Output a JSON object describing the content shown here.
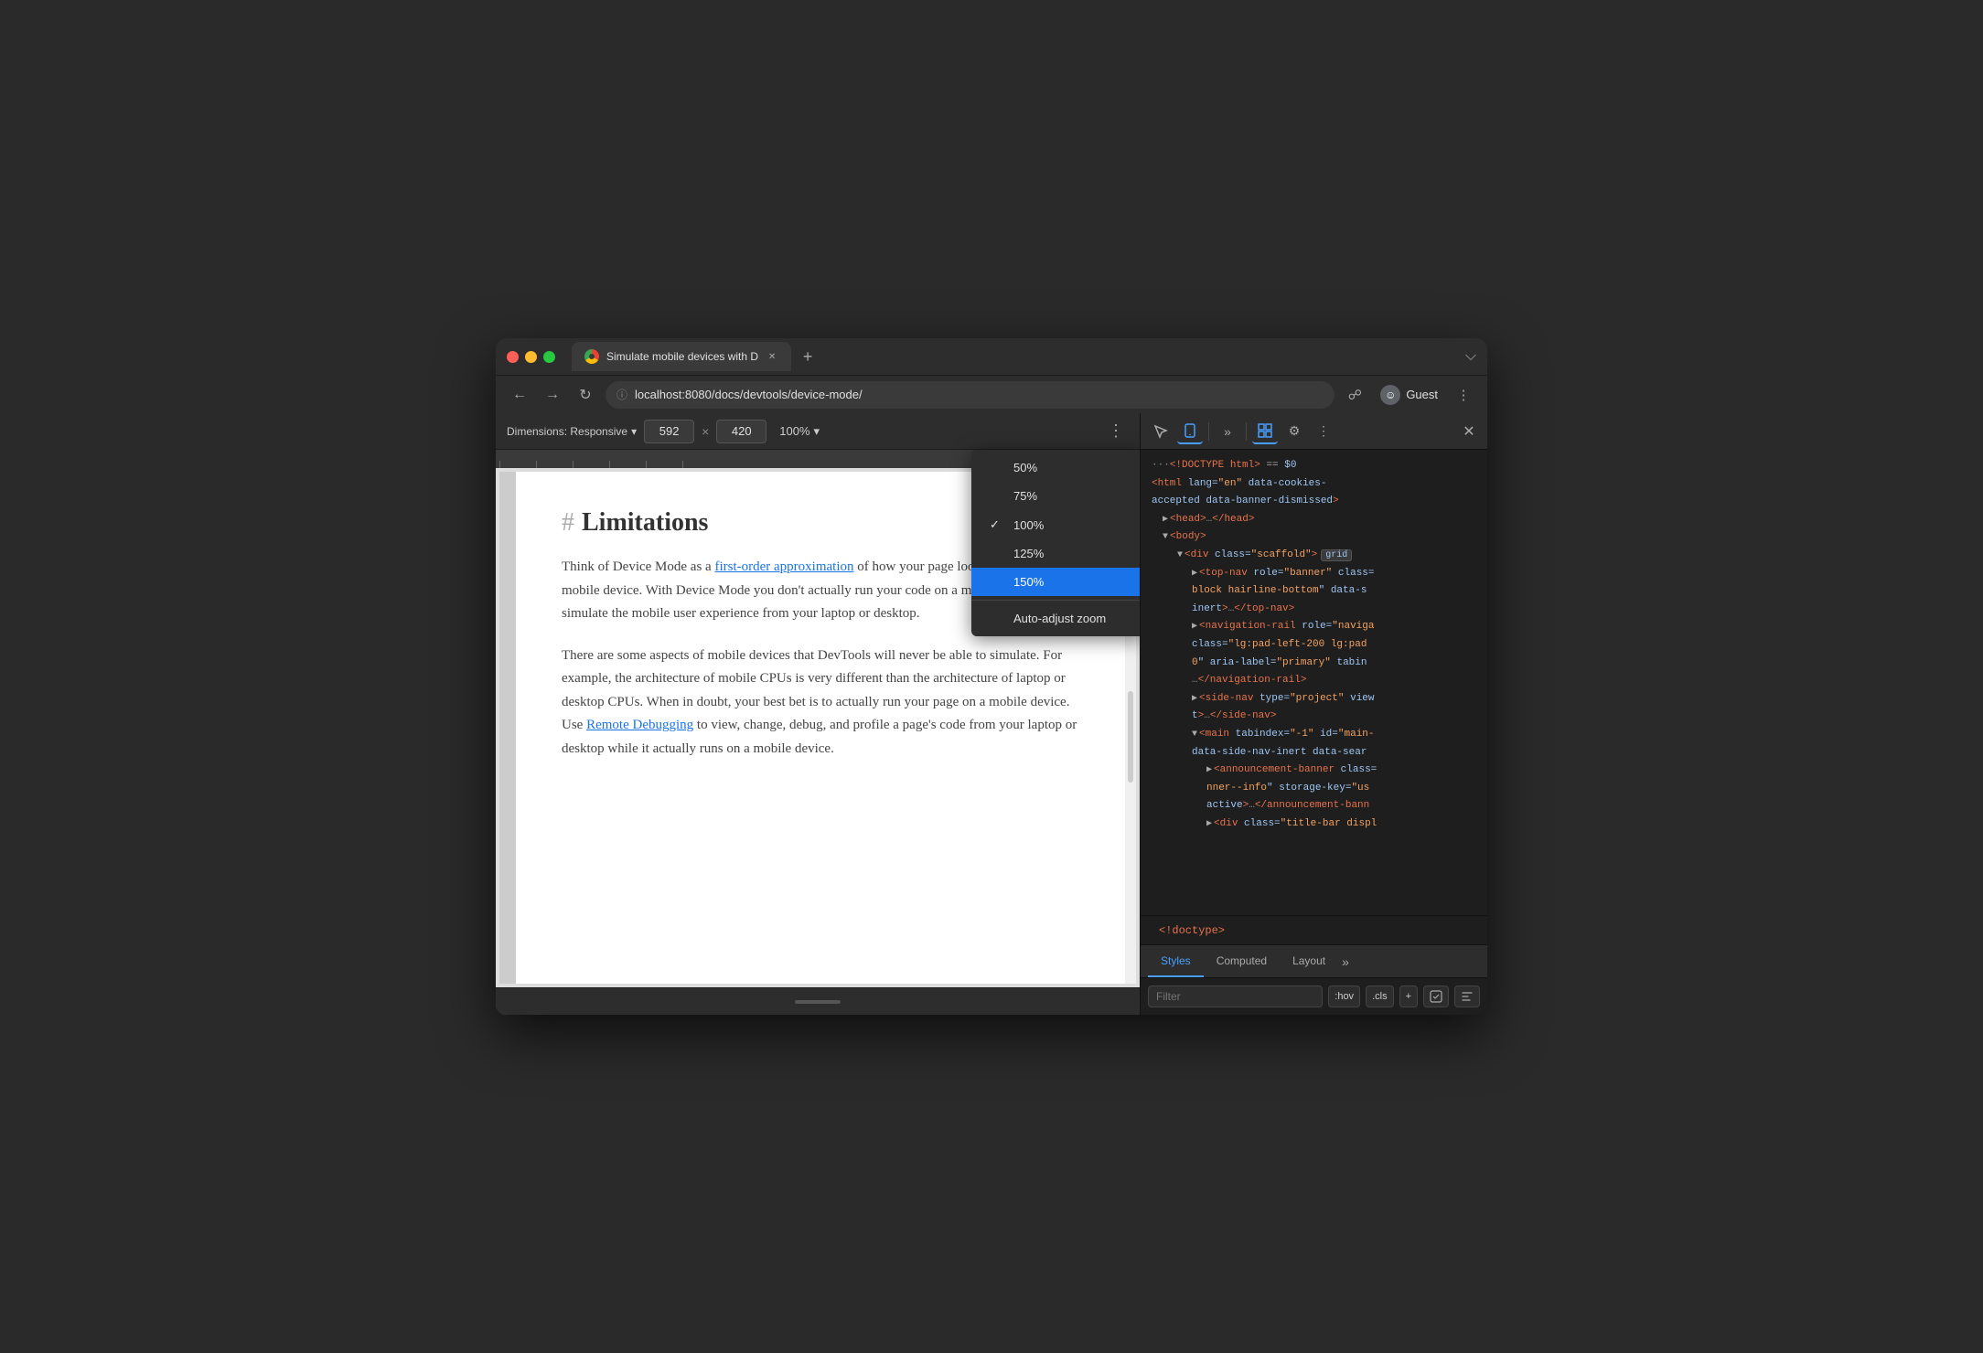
{
  "window": {
    "title": "Chrome Browser",
    "tab_title": "Simulate mobile devices with D",
    "url": "localhost:8080/docs/devtools/device-mode/",
    "profile_name": "Guest"
  },
  "device_toolbar": {
    "dimensions_label": "Dimensions: Responsive",
    "width": "592",
    "height": "420",
    "zoom": "100%",
    "zoom_arrow": "▾"
  },
  "zoom_dropdown": {
    "options": [
      {
        "label": "50%",
        "selected": false,
        "value": "50"
      },
      {
        "label": "75%",
        "selected": false,
        "value": "75"
      },
      {
        "label": "100%",
        "selected": true,
        "value": "100"
      },
      {
        "label": "125%",
        "selected": false,
        "value": "125"
      },
      {
        "label": "150%",
        "selected": false,
        "value": "150"
      }
    ],
    "auto_adjust_label": "Auto-adjust zoom"
  },
  "page": {
    "heading_hash": "#",
    "heading": "Limitations",
    "paragraph1": "Think of Device Mode as a ",
    "link1": "first-order approximation",
    "paragraph1_rest": " of how your page looks and feels on a mobile device. With Device Mode you don't actually run your code on a mobile device. You simulate the mobile user experience from your laptop or desktop.",
    "paragraph2": "There are some aspects of mobile devices that DevTools will never be able to simulate. For example, the architecture of mobile CPUs is very different than the architecture of laptop or desktop CPUs. When in doubt, your best bet is to actually run your page on a mobile device. Use ",
    "link2": "Remote Debugging",
    "paragraph2_rest": " to view, change, debug, and profile a page's code from your laptop or desktop while it actually runs on a mobile device."
  },
  "devtools": {
    "dom_lines": [
      {
        "indent": 0,
        "html": "···<!DOCTYPE html> == $0",
        "type": "comment"
      },
      {
        "indent": 0,
        "html": "<html lang=\"en\" data-cookies-",
        "type": "tag"
      },
      {
        "indent": 0,
        "html": "accepted data-banner-dismissed>",
        "type": "tag"
      },
      {
        "indent": 1,
        "html": "▶ <head>…</head>",
        "type": "tag"
      },
      {
        "indent": 1,
        "html": "▼ <body>",
        "type": "tag"
      },
      {
        "indent": 2,
        "html": "▼ <div class=\"scaffold\">",
        "type": "tag",
        "badge": "grid"
      },
      {
        "indent": 3,
        "html": "▶ <top-nav role=\"banner\" class=",
        "type": "tag"
      },
      {
        "indent": 3,
        "html": "block hairline-bottom\" data-s",
        "type": "tag"
      },
      {
        "indent": 3,
        "html": "inert>…</top-nav>",
        "type": "tag"
      },
      {
        "indent": 3,
        "html": "▶ <navigation-rail role=\"naviga",
        "type": "tag"
      },
      {
        "indent": 3,
        "html": "class=\"lg:pad-left-200 lg:pad",
        "type": "tag"
      },
      {
        "indent": 3,
        "html": "0\" aria-label=\"primary\" tabin",
        "type": "tag"
      },
      {
        "indent": 3,
        "html": "…</navigation-rail>",
        "type": "tag"
      },
      {
        "indent": 3,
        "html": "▶ <side-nav type=\"project\" view",
        "type": "tag"
      },
      {
        "indent": 3,
        "html": "t\">…</side-nav>",
        "type": "tag"
      },
      {
        "indent": 3,
        "html": "▼ <main tabindex=\"-1\" id=\"main-",
        "type": "tag"
      },
      {
        "indent": 3,
        "html": "data-side-nav-inert data-sear",
        "type": "tag"
      },
      {
        "indent": 4,
        "html": "▶ <announcement-banner class=",
        "type": "tag"
      },
      {
        "indent": 4,
        "html": "nner--info\" storage-key=\"us",
        "type": "tag"
      },
      {
        "indent": 4,
        "html": "active>…</announcement-bann",
        "type": "tag"
      },
      {
        "indent": 4,
        "html": "▶ <div class=\"title-bar displ",
        "type": "tag"
      }
    ],
    "doctype": "<!doctype>",
    "tabs": [
      "Styles",
      "Computed",
      "Layout"
    ],
    "active_tab": "Styles",
    "filter_placeholder": "Filter",
    "hov_label": ":hov",
    "cls_label": ".cls",
    "add_label": "+"
  }
}
